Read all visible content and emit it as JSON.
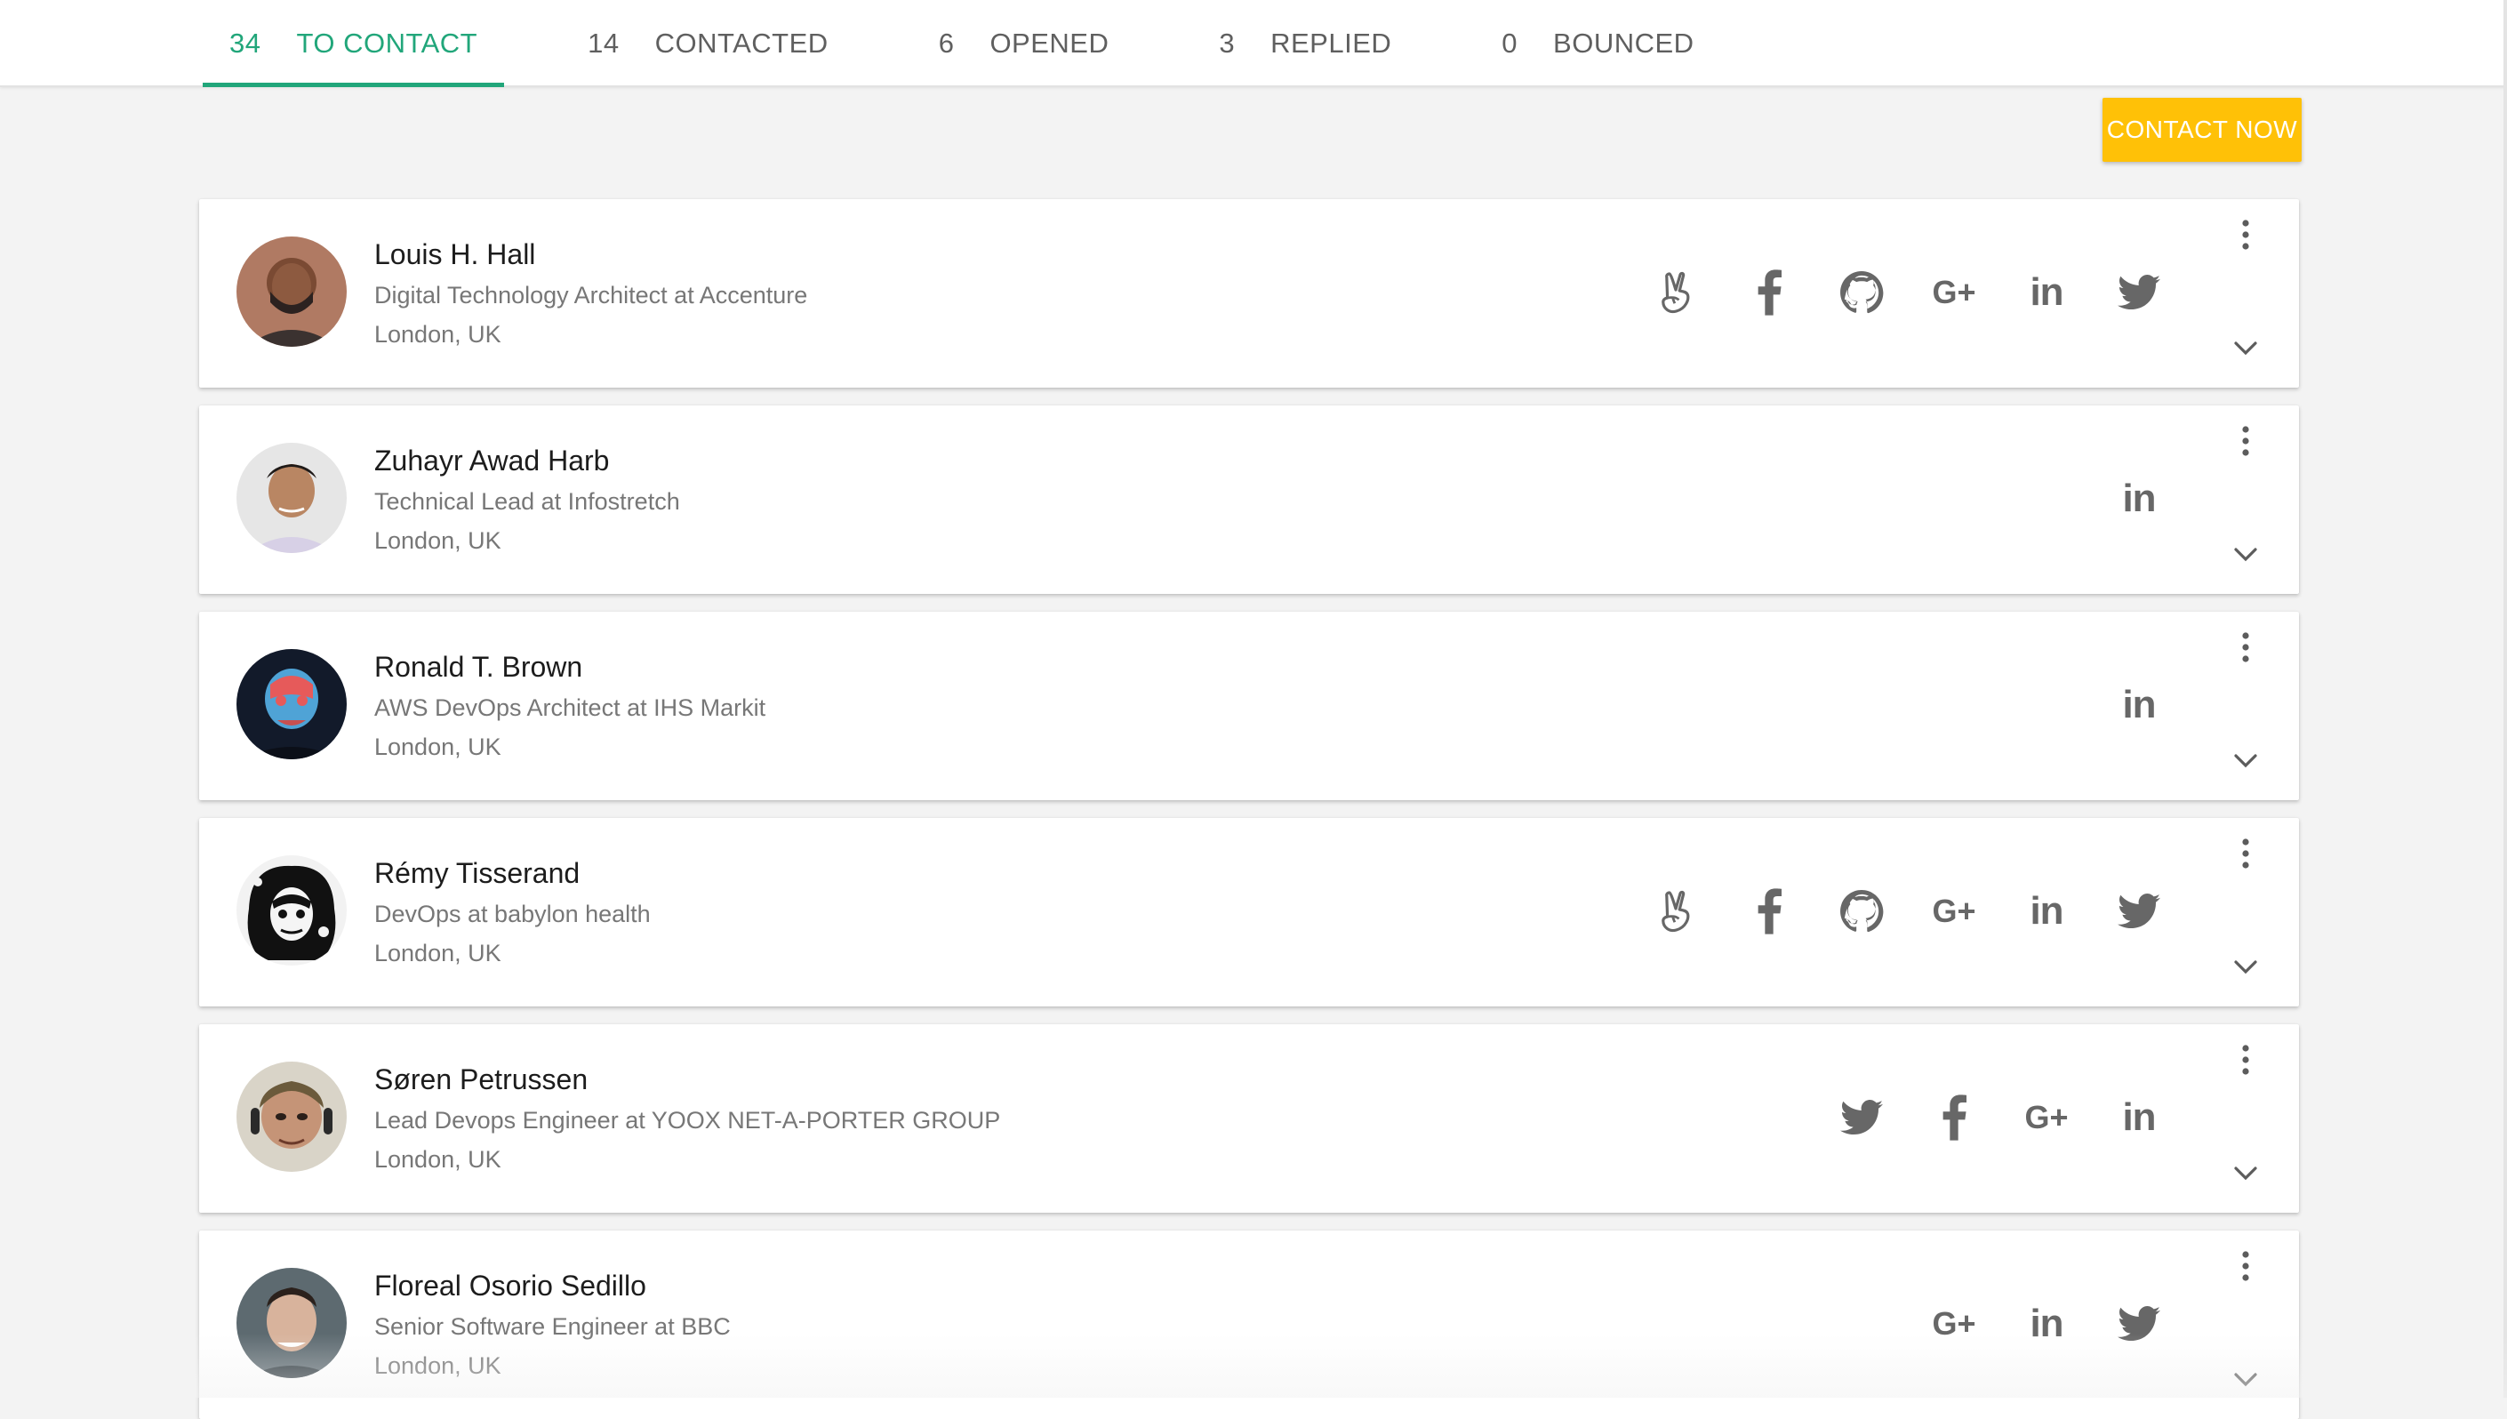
{
  "tabs": [
    {
      "count": "34",
      "label": "TO CONTACT",
      "active": true
    },
    {
      "count": "14",
      "label": "CONTACTED"
    },
    {
      "count": "6",
      "label": "OPENED"
    },
    {
      "count": "3",
      "label": "REPLIED"
    },
    {
      "count": "0",
      "label": "BOUNCED"
    }
  ],
  "actions": {
    "contact_now": "CONTACT NOW"
  },
  "colors": {
    "accent": "#21a67a",
    "button": "#ffc107",
    "icon": "#676767"
  },
  "contacts": [
    {
      "name": "Louis H. Hall",
      "title": "Digital Technology Architect at Accenture",
      "location": "London, UK",
      "socials": [
        "angellist",
        "facebook",
        "github",
        "google-plus",
        "linkedin",
        "twitter"
      ]
    },
    {
      "name": "Zuhayr Awad Harb",
      "title": "Technical Lead at Infostretch",
      "location": "London, UK",
      "socials": [
        "linkedin"
      ]
    },
    {
      "name": "Ronald T. Brown",
      "title": "AWS DevOps Architect at IHS Markit",
      "location": "London, UK",
      "socials": [
        "linkedin"
      ]
    },
    {
      "name": "Rémy Tisserand",
      "title": "DevOps at babylon health",
      "location": "London, UK",
      "socials": [
        "angellist",
        "facebook",
        "github",
        "google-plus",
        "linkedin",
        "twitter"
      ]
    },
    {
      "name": "Søren Petrussen",
      "title": "Lead Devops Engineer at YOOX NET-A-PORTER GROUP",
      "location": "London, UK",
      "socials": [
        "twitter",
        "facebook",
        "google-plus",
        "linkedin"
      ]
    },
    {
      "name": "Floreal Osorio Sedillo",
      "title": "Senior Software Engineer at BBC",
      "location": "London, UK",
      "socials": [
        "google-plus",
        "linkedin",
        "twitter"
      ]
    }
  ]
}
